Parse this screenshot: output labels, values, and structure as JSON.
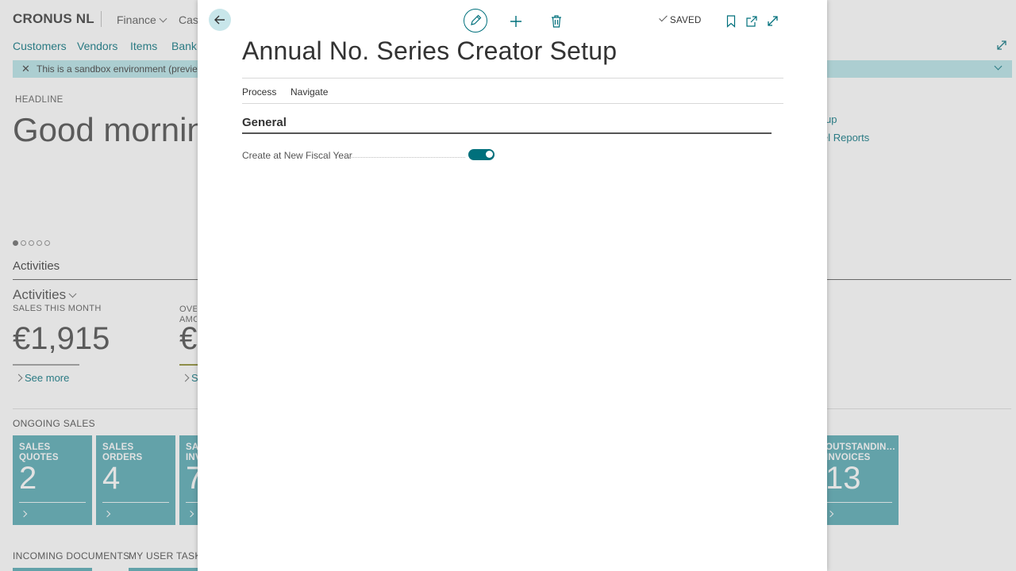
{
  "app": {
    "company": "CRONUS NL",
    "top_menu": [
      {
        "label": "Finance",
        "dropdown": true
      },
      {
        "label": "Cash",
        "dropdown": false
      }
    ],
    "nav_links": [
      "Customers",
      "Vendors",
      "Items",
      "Bank"
    ],
    "sandbox_notice": "This is a sandbox environment (preview)",
    "headline_caption": "HEADLINE",
    "greeting": "Good morning",
    "right_links": [
      "up",
      "el Reports"
    ],
    "carousel": {
      "total": 5,
      "active": 0
    },
    "activities_section": "Activities",
    "activities_group": "Activities",
    "cues": [
      {
        "caption": "SALES THIS MONTH",
        "value": "€1,915",
        "see_more": "See more",
        "line_color": "#888888"
      },
      {
        "caption": "OVE AMO",
        "value": "€",
        "see_more": "Se",
        "line_color": "#8a8a2a"
      }
    ],
    "ongoing_sales_caption": "ONGOING SALES",
    "tiles": [
      {
        "caption": "SALES QUOTES",
        "value": "2"
      },
      {
        "caption": "SALES ORDERS",
        "value": "4"
      },
      {
        "caption": "SA INV",
        "value": "7"
      },
      {
        "caption": "OUTSTANDIN… INVOICES",
        "value": "13"
      }
    ],
    "bottom_captions": [
      "INCOMING DOCUMENTS",
      "MY USER TASKS"
    ],
    "colors": {
      "accent": "#00707c",
      "tile": "#4fa7b1",
      "sandbox": "#b5e4e8"
    }
  },
  "dialog": {
    "toolbar": {
      "back_icon": "arrow-left-icon",
      "edit_icon": "pencil-icon",
      "new_icon": "plus-icon",
      "delete_icon": "trash-icon",
      "saved_label": "SAVED",
      "bookmark_icon": "bookmark-icon",
      "share_icon": "open-new-window-icon",
      "expand_icon": "expand-icon"
    },
    "title": "Annual No. Series Creator Setup",
    "actions": [
      "Process",
      "Navigate"
    ],
    "fasttab": "General",
    "fields": [
      {
        "label": "Create at New Fiscal Year",
        "type": "toggle",
        "value": true
      }
    ]
  }
}
